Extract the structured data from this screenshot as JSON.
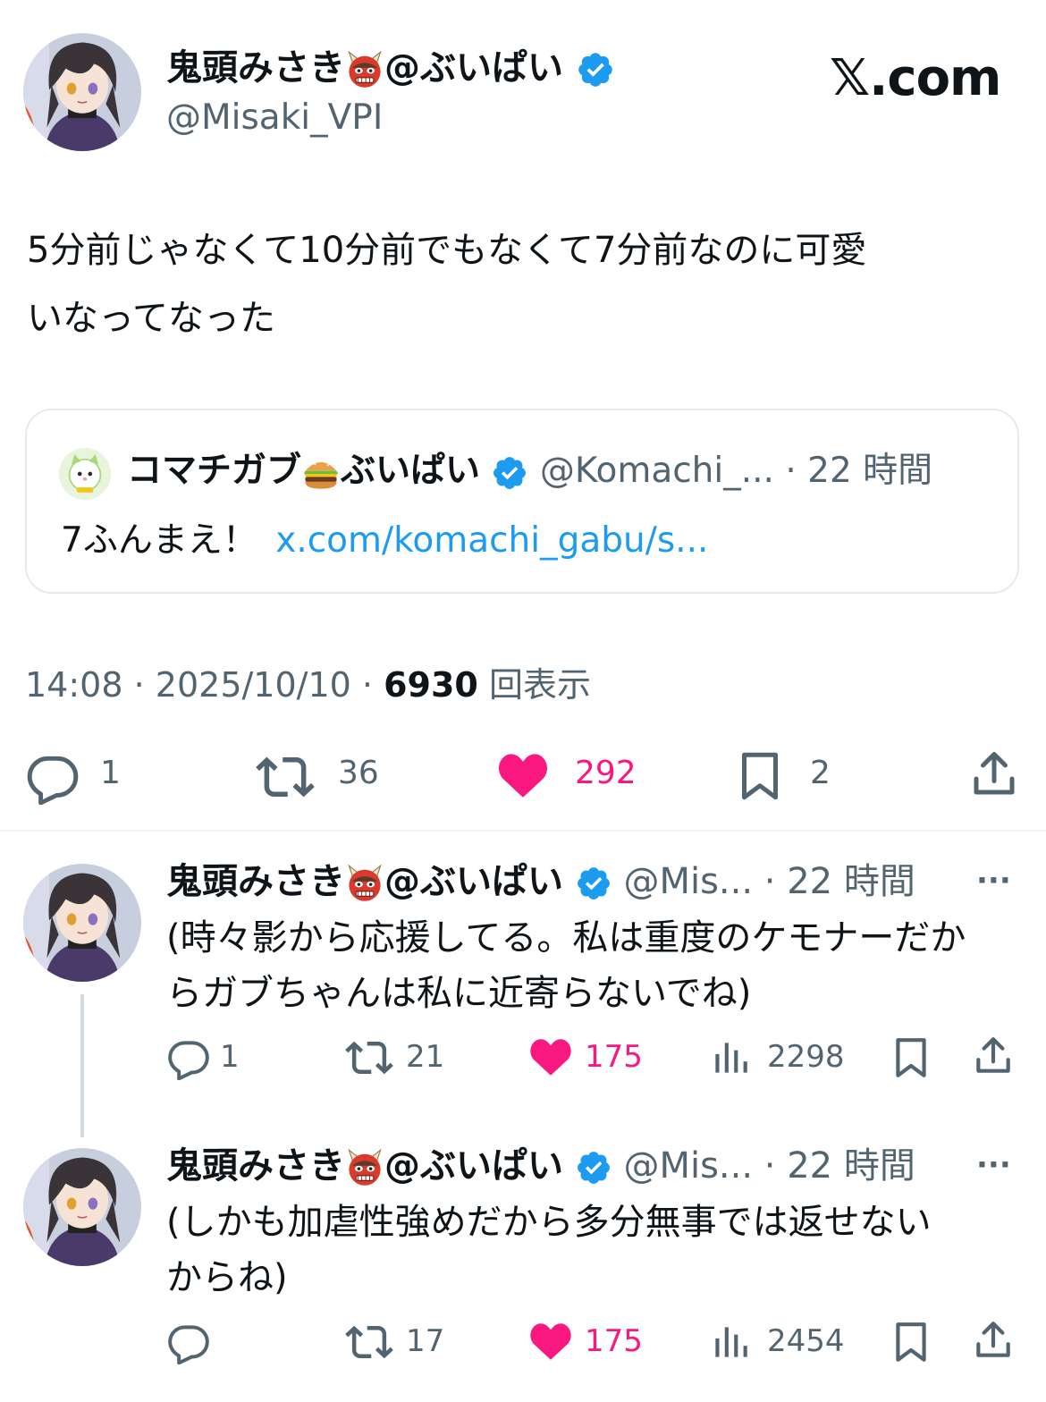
{
  "brand": {
    "logo_text": "𝕏.com"
  },
  "main_tweet": {
    "display_name": "鬼頭みさき",
    "display_suffix": "@ぶいぱい",
    "handle": "@Misaki_VPI",
    "text_line1": "5分前じゃなくて10分前でもなくて7分前なのに可愛",
    "text_line2": "いなってなった",
    "quote": {
      "display_name": "コマチガブ",
      "display_suffix": "ぶいぱい",
      "handle": "@Komachi_...",
      "separator": "·",
      "time": "22 時間",
      "text": "7ふんまえ！",
      "link": "x.com/komachi_gabu/s..."
    },
    "meta": {
      "time": "14:08",
      "dot1": "·",
      "date": "2025/10/10",
      "dot2": "·",
      "views": "6930",
      "views_label": "回表示"
    },
    "actions": {
      "replies": "1",
      "retweets": "36",
      "likes": "292",
      "bookmarks": "2"
    }
  },
  "replies": [
    {
      "display_name": "鬼頭みさき",
      "display_suffix": "@ぶいぱい",
      "handle": "@Mis...",
      "separator": "·",
      "time": "22 時間",
      "more": "···",
      "text_line1": "(時々影から応援してる。私は重度のケモナーだか",
      "text_line2": "らガブちゃんは私に近寄らないでね)",
      "actions": {
        "replies": "1",
        "retweets": "21",
        "likes": "175",
        "views": "2298"
      }
    },
    {
      "display_name": "鬼頭みさき",
      "display_suffix": "@ぶいぱい",
      "handle": "@Mis...",
      "separator": "·",
      "time": "22 時間",
      "more": "···",
      "text_line1": "(しかも加虐性強めだから多分無事では返せない",
      "text_line2": "からね)",
      "actions": {
        "replies": "",
        "retweets": "17",
        "likes": "175",
        "views": "2454"
      }
    }
  ],
  "colors": {
    "like": "#f91880",
    "link": "#1d9bf0",
    "verified": "#1d9bf0",
    "muted": "#536471"
  }
}
